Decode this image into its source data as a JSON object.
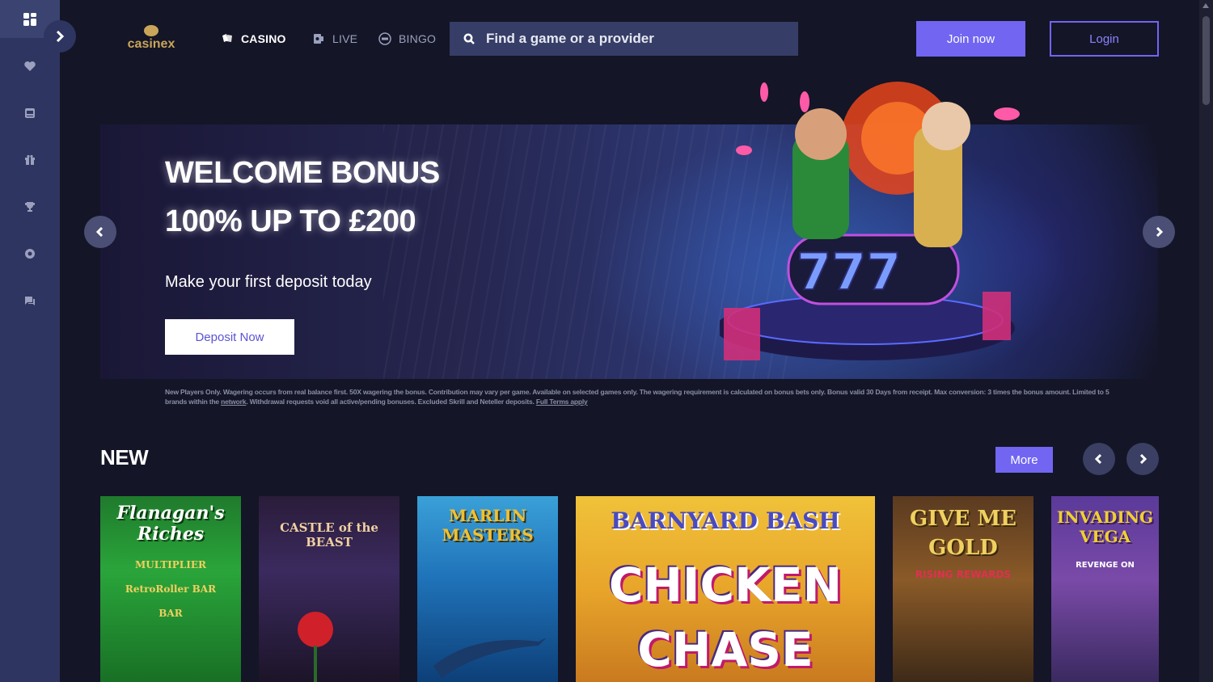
{
  "sidebar": {
    "items": [
      {
        "icon": "grid-icon"
      },
      {
        "icon": "heart-icon"
      },
      {
        "icon": "slot-machine-icon"
      },
      {
        "icon": "gift-icon"
      },
      {
        "icon": "trophy-icon"
      },
      {
        "icon": "lifebuoy-icon"
      },
      {
        "icon": "chat-icon"
      }
    ]
  },
  "header": {
    "logo": "casinex",
    "nav": [
      {
        "label": "CASINO",
        "icon": "cards-icon",
        "active": true
      },
      {
        "label": "LIVE",
        "icon": "live-icon",
        "active": false
      },
      {
        "label": "BINGO",
        "icon": "bingo-icon",
        "active": false
      }
    ],
    "search": {
      "placeholder": "Find a game or a provider"
    },
    "join_label": "Join now",
    "login_label": "Login"
  },
  "banner": {
    "title_line1": "WELCOME BONUS",
    "title_line2": "100% UP TO £200",
    "subtitle": "Make your first deposit today",
    "cta_label": "Deposit Now",
    "reel_symbols": "777"
  },
  "terms": {
    "text": "New Players Only. Wagering occurs from real balance first. 50X wagering the bonus. Contribution may vary per game. Available on selected games only. The wagering requirement is calculated on bonus bets only. Bonus valid 30 Days from receipt. Max conversion: 3 times the bonus amount. Limited to 5 brands within the ",
    "link_network": "network",
    "text2": ". Withdrawal requests void all active/pending bonuses. Excluded Skrill and Neteller deposits. ",
    "link_full_terms": "Full Terms apply"
  },
  "new_section": {
    "title": "NEW",
    "more_label": "More",
    "games": [
      {
        "title": "Flanagan's Riches",
        "subtitle": "MULTIPLIER RetroRoller BAR BAR"
      },
      {
        "title": "CASTLE of the BEAST",
        "subtitle": ""
      },
      {
        "title": "MARLIN MASTERS",
        "subtitle": ""
      },
      {
        "title": "BARNYARD BASH",
        "subtitle": "CHICKEN CHASE"
      },
      {
        "title": "GIVE ME GOLD",
        "subtitle": "RISING REWARDS"
      },
      {
        "title": "INVADING VEGA",
        "subtitle": "REVENGE ON"
      }
    ]
  },
  "colors": {
    "accent": "#7165f2",
    "background": "#141526",
    "sidebar": "#2e3560",
    "gold": "#c9a55a"
  }
}
